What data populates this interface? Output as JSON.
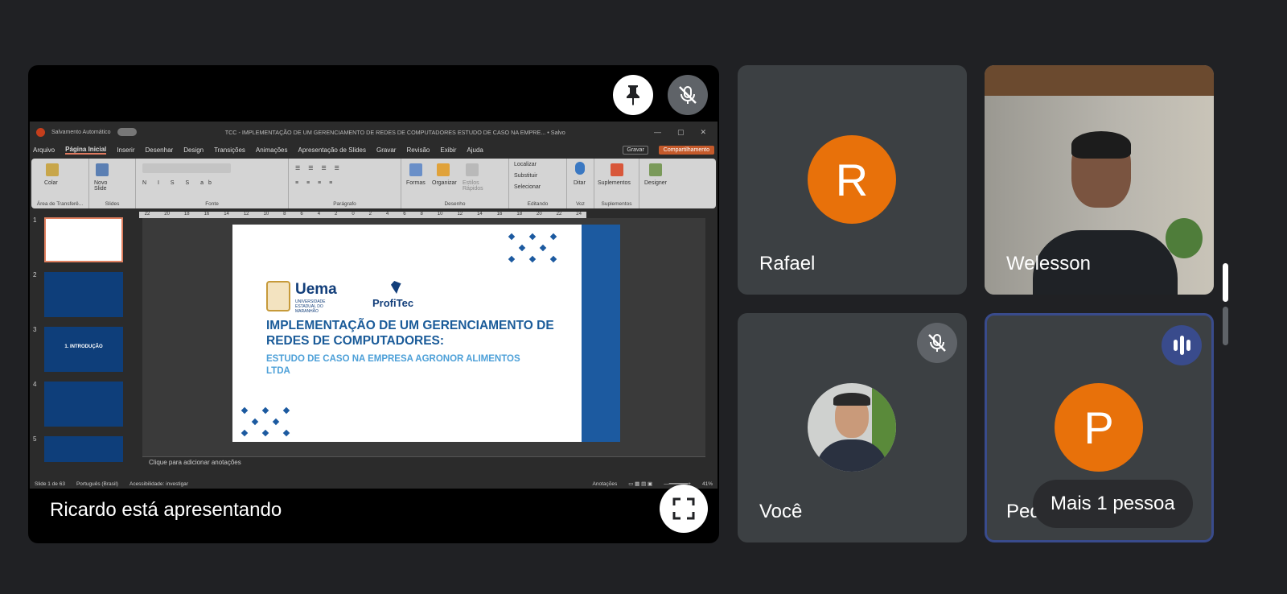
{
  "presentation": {
    "presenter_label": "Ricardo está apresentando",
    "pin_icon": "pin-icon",
    "mic_off_icon": "mic-off-icon",
    "fullscreen_icon": "fullscreen-icon"
  },
  "ppt": {
    "autosave_label": "Salvamento Automático",
    "doc_title": "TCC - IMPLEMENTAÇÃO DE UM GERENCIAMENTO DE REDES DE COMPUTADORES ESTUDO DE CASO NA EMPRE... • Salvo",
    "menu": [
      "Arquivo",
      "Página Inicial",
      "Inserir",
      "Desenhar",
      "Design",
      "Transições",
      "Animações",
      "Apresentação de Slides",
      "Gravar",
      "Revisão",
      "Exibir",
      "Ajuda"
    ],
    "record_label": "Gravar",
    "share_label": "Compartilhamento",
    "ribbon": {
      "clipboard": "Área de Transferê...",
      "paste": "Colar",
      "slides": "Slides",
      "new_slide": "Novo Slide",
      "font": "Fonte",
      "paragraph": "Parágrafo",
      "drawing": "Desenho",
      "shapes": "Formas",
      "arrange": "Organizar",
      "quick_styles": "Estilos Rápidos",
      "editing": "Editando",
      "find": "Localizar",
      "replace": "Substituir",
      "select": "Selecionar",
      "voice": "Voz",
      "dictate": "Ditar",
      "addins_group": "Suplementos",
      "addins": "Suplementos",
      "designer": "Designer"
    },
    "ruler_ticks": [
      "24",
      "22",
      "20",
      "18",
      "16",
      "14",
      "12",
      "10",
      "8",
      "6",
      "4",
      "2",
      "0",
      "2",
      "4",
      "6",
      "8",
      "10",
      "12",
      "14",
      "16",
      "18",
      "20",
      "22",
      "24"
    ],
    "thumbnails": [
      {
        "num": "1",
        "label": ""
      },
      {
        "num": "2",
        "label": ""
      },
      {
        "num": "3",
        "label": "1. INTRODUÇÃO"
      },
      {
        "num": "4",
        "label": ""
      },
      {
        "num": "5",
        "label": ""
      }
    ],
    "slide": {
      "logo_uema": "Uema",
      "logo_uema_sub": "UNIVERSIDADE ESTADUAL DO MARANHÃO",
      "logo_profitec": "ProfiTec",
      "title": "IMPLEMENTAÇÃO DE UM GERENCIAMENTO DE REDES DE COMPUTADORES:",
      "subtitle": "ESTUDO DE CASO NA EMPRESA AGRONOR ALIMENTOS LTDA"
    },
    "notes_placeholder": "Clique para adicionar anotações",
    "status": {
      "slide_count": "Slide 1 de 63",
      "language": "Português (Brasil)",
      "accessibility": "Acessibilidade: investigar",
      "notes": "Anotações",
      "zoom": "41%"
    }
  },
  "participants": [
    {
      "name": "Rafael",
      "initial": "R",
      "color": "#e8710a"
    },
    {
      "name": "Welesson"
    },
    {
      "name": "Você"
    },
    {
      "name": "Pedro",
      "initial": "P",
      "color": "#e8710a"
    }
  ],
  "more_people": "Mais 1 pessoa",
  "colors": {
    "background": "#202124",
    "tile": "#3c4043",
    "avatar_orange": "#e8710a",
    "active_speaker_border": "#394b8c"
  }
}
